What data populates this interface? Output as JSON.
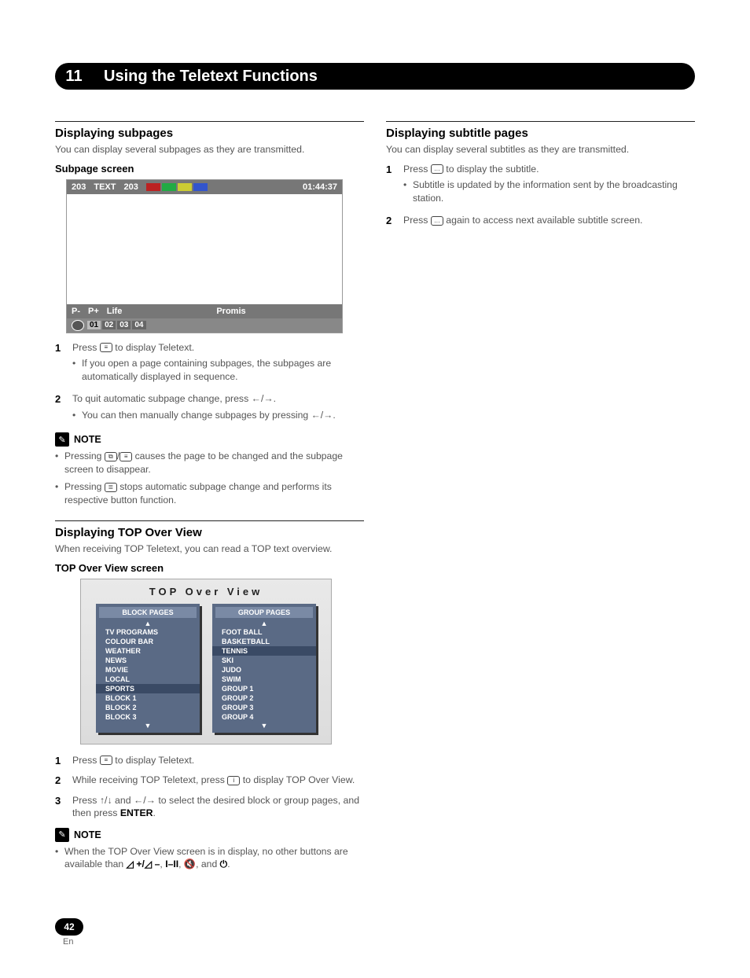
{
  "chapter": {
    "number": "11",
    "title": "Using the Teletext Functions"
  },
  "left": {
    "subpages": {
      "heading": "Displaying subpages",
      "lead": "You can display several subpages as they are transmitted.",
      "screen_label": "Subpage screen",
      "ttx": {
        "page_left": "203",
        "text_label": "TEXT",
        "page_mid": "203",
        "clock": "01:44:37",
        "p_minus": "P-",
        "p_plus": "P+",
        "life": "Life",
        "promis": "Promis",
        "sub1": "01",
        "sub2": "02",
        "sub3": "03",
        "sub4": "04"
      },
      "step1": "Press ",
      "step1b": " to display Teletext.",
      "step1_sub": "If you open a page containing subpages, the subpages are automatically displayed in sequence.",
      "step2a": "To quit automatic subpage change, press ",
      "step2b": ".",
      "step2_sub_a": "You can then manually change subpages by pressing ",
      "step2_sub_b": ".",
      "note": "NOTE",
      "note1a": "Pressing ",
      "note1b": " causes the page to be changed and the subpage screen to disappear.",
      "note2a": "Pressing ",
      "note2b": " stops automatic subpage change and performs its respective button function."
    },
    "top": {
      "heading": "Displaying TOP Over View",
      "lead": "When receiving TOP Teletext, you can read a TOP text overview.",
      "screen_label": "TOP Over View screen",
      "tov_title": "TOP Over View",
      "block_hdr": "BLOCK PAGES",
      "group_hdr": "GROUP PAGES",
      "block_items": [
        "TV PROGRAMS",
        "COLOUR BAR",
        "WEATHER",
        "NEWS",
        "MOVIE",
        "LOCAL",
        "SPORTS",
        "BLOCK 1",
        "BLOCK 2",
        "BLOCK 3"
      ],
      "block_highlight": "SPORTS",
      "group_items": [
        "FOOT BALL",
        "BASKETBALL",
        "TENNIS",
        "SKI",
        "JUDO",
        "SWIM",
        "GROUP 1",
        "GROUP 2",
        "GROUP 3",
        "GROUP 4"
      ],
      "group_highlight": "TENNIS",
      "step1": "Press ",
      "step1b": " to display Teletext.",
      "step2a": "While receiving TOP Teletext, press ",
      "step2b": " to display TOP Over View.",
      "step3a": "Press ",
      "step3b": " and ",
      "step3c": " to select the desired block or group pages, and then press ",
      "step3d": ".",
      "enter": "ENTER",
      "note": "NOTE",
      "note1a": "When the TOP Over View screen is in display, no other buttons are available than ",
      "note1b": ", ",
      "note1c": ", and ",
      "note1d": "."
    }
  },
  "right": {
    "heading": "Displaying subtitle pages",
    "lead": "You can display several subtitles as they are transmitted.",
    "step1a": "Press ",
    "step1b": " to display the subtitle.",
    "step1_sub": "Subtitle is updated by the information sent by the broadcasting station.",
    "step2a": "Press ",
    "step2b": " again to access next available subtitle screen."
  },
  "icons": {
    "teletext": "≡",
    "subpage": "⧉",
    "hold": "≣",
    "info": "i",
    "subtitle": "…",
    "left": "←",
    "right": "→",
    "up": "↑",
    "down": "↓",
    "volplus": "◿ +/",
    "volminus": "◿ –",
    "pause": "I–II",
    "mute": "🔇",
    "power": "⏻"
  },
  "footer": {
    "page": "42",
    "lang": "En"
  }
}
